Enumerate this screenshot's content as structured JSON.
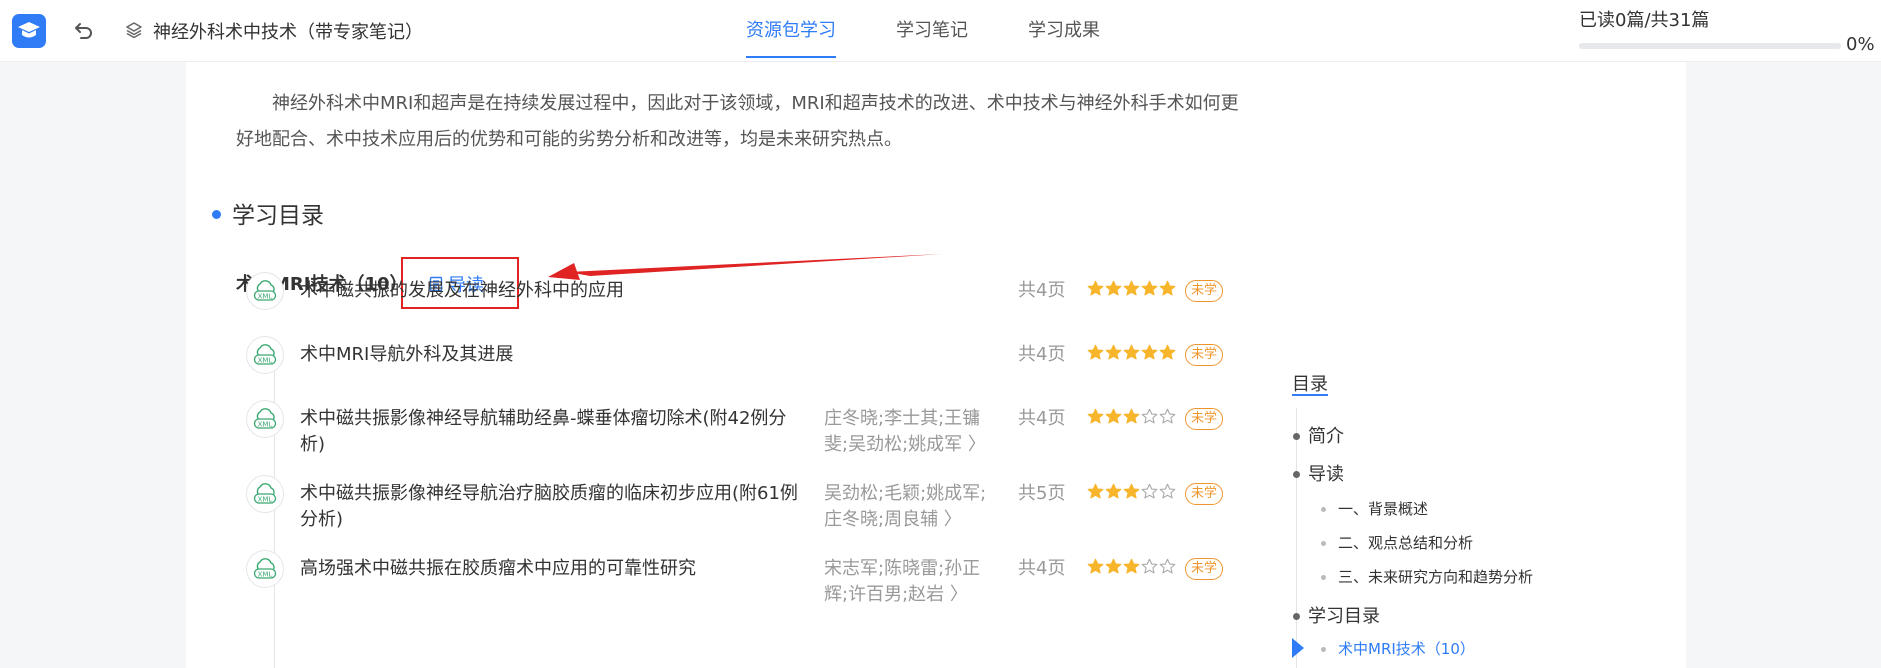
{
  "header": {
    "course_title": "神经外科术中技术（带专家笔记）",
    "tabs": [
      {
        "label": "资源包学习",
        "active": true
      },
      {
        "label": "学习笔记",
        "active": false
      },
      {
        "label": "学习成果",
        "active": false
      }
    ],
    "progress_text": "已读0篇/共31篇",
    "progress_percent": "0%",
    "progress_fraction": 0
  },
  "content": {
    "intro_text": "神经外科术中MRI和超声是在持续发展过程中，因此对于该领域，MRI和超声技术的改进、术中技术与神经外科手术如何更好地配合、术中技术应用后的优势和可能的劣势分析和改进等，均是未来研究热点。",
    "section_title": "学习目录",
    "chapter_title": "术中MRI技术（10）",
    "guide_label": "导读",
    "items": [
      {
        "title": "术中磁共振的发展及在神经外科中的应用",
        "authors": "",
        "pages": "共4页",
        "rating": 5,
        "status": "未学",
        "icon": "xml-icon"
      },
      {
        "title": "术中MRI导航外科及其进展",
        "authors": "",
        "pages": "共4页",
        "rating": 5,
        "status": "未学",
        "icon": "xml-icon"
      },
      {
        "title": "术中磁共振影像神经导航辅助经鼻-蝶垂体瘤切除术(附42例分析)",
        "authors": "庄冬晓;李士其;王镛斐;吴劲松;姚成军 〉",
        "pages": "共4页",
        "rating": 3,
        "status": "未学",
        "icon": "xml-icon"
      },
      {
        "title": "术中磁共振影像神经导航治疗脑胶质瘤的临床初步应用(附61例分析)",
        "authors": "吴劲松;毛颖;姚成军;庄冬晓;周良辅 〉",
        "pages": "共5页",
        "rating": 3,
        "status": "未学",
        "icon": "xml-icon"
      },
      {
        "title": "高场强术中磁共振在胶质瘤术中应用的可靠性研究",
        "authors": "宋志军;陈晓雷;孙正辉;许百男;赵岩 〉",
        "pages": "共4页",
        "rating": 3,
        "status": "未学",
        "icon": "xml-icon"
      }
    ]
  },
  "toc": {
    "title": "目录",
    "items": [
      {
        "label": "简介",
        "level": 1
      },
      {
        "label": "导读",
        "level": 1
      },
      {
        "label": "一、背景概述",
        "level": 2
      },
      {
        "label": "二、观点总结和分析",
        "level": 2
      },
      {
        "label": "三、未来研究方向和趋势分析",
        "level": 2
      },
      {
        "label": "学习目录",
        "level": 1
      },
      {
        "label": "术中MRI技术（10）",
        "level": 2,
        "active": true
      }
    ]
  },
  "colors": {
    "accent": "#2f7cf6",
    "star_filled": "#f7b52c",
    "badge": "#f0962e",
    "highlight_box": "#e02424"
  }
}
